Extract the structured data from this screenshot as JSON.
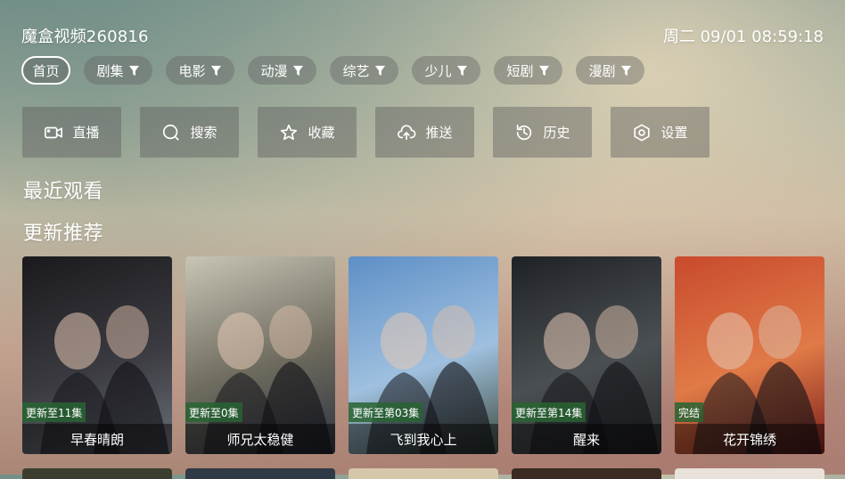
{
  "app": {
    "title": "魔盒视频260816",
    "clock": "周二 09/01 08:59:18"
  },
  "tabs": [
    {
      "label": "首页",
      "active": true
    },
    {
      "label": "剧集",
      "filter": true
    },
    {
      "label": "电影",
      "filter": true
    },
    {
      "label": "动漫",
      "filter": true
    },
    {
      "label": "综艺",
      "filter": true
    },
    {
      "label": "少儿",
      "filter": true
    },
    {
      "label": "短剧",
      "filter": true
    },
    {
      "label": "漫剧",
      "filter": true
    }
  ],
  "actions": [
    {
      "label": "直播",
      "icon": "camera-icon"
    },
    {
      "label": "搜索",
      "icon": "search-icon"
    },
    {
      "label": "收藏",
      "icon": "star-icon"
    },
    {
      "label": "推送",
      "icon": "cloud-upload-icon"
    },
    {
      "label": "历史",
      "icon": "history-icon"
    },
    {
      "label": "设置",
      "icon": "gear-icon"
    }
  ],
  "sections": {
    "recent": "最近观看",
    "recommend": "更新推荐"
  },
  "cards": [
    {
      "title": "早春晴朗",
      "badge": "更新至11集",
      "art": "早春晴朗",
      "colors": [
        "#1a1a1e",
        "#3a3a40",
        "#6b6e77"
      ]
    },
    {
      "title": "师兄太稳健",
      "badge": "更新至0集",
      "art": "师兄太稳健",
      "colors": [
        "#c7c5b6",
        "#6e6b5e",
        "#2e3340"
      ]
    },
    {
      "title": "飞到我心上",
      "badge": "更新至第03集",
      "art": "飞到我心上",
      "colors": [
        "#5d8fc6",
        "#9fc0df",
        "#3d4a3c"
      ]
    },
    {
      "title": "醒来",
      "badge": "更新至第14集",
      "art": "",
      "colors": [
        "#1f2225",
        "#4a4f52",
        "#2a2b2c"
      ]
    },
    {
      "title": "花开锦绣",
      "badge": "完结",
      "art": "花开锦绣",
      "colors": [
        "#c94a2d",
        "#e07a47",
        "#7a1e1a"
      ]
    }
  ],
  "peek_colors": [
    "#3b3e2f",
    "#2f3a46",
    "#d6c7a8",
    "#3b2b22",
    "#e8e2da"
  ]
}
